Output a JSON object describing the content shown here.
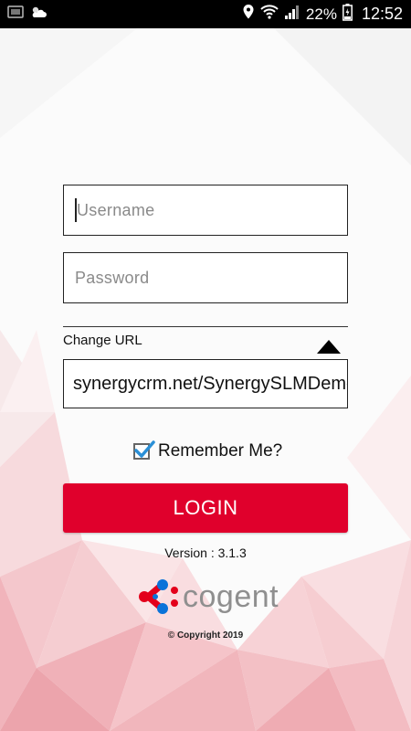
{
  "status_bar": {
    "notification_icons": [
      "sim-icon",
      "weather-icon"
    ],
    "right_icons": [
      "location-icon",
      "wifi-icon",
      "signal-icon"
    ],
    "battery": "22%",
    "time": "12:52"
  },
  "form": {
    "username_placeholder": "Username",
    "password_placeholder": "Password",
    "change_url_label": "Change URL",
    "url_value": "synergycrm.net/SynergySLMDemo",
    "remember_label": "Remember Me?",
    "remember_checked": true,
    "login_label": "LOGIN"
  },
  "footer": {
    "version": "Version : 3.1.3",
    "logo_text": "cogent",
    "copyright": "© Copyright 2019"
  },
  "colors": {
    "accent": "#e0002c",
    "logo_red": "#e3001b",
    "logo_blue": "#0a73d9",
    "checkbox_blue": "#2a8fd6"
  }
}
